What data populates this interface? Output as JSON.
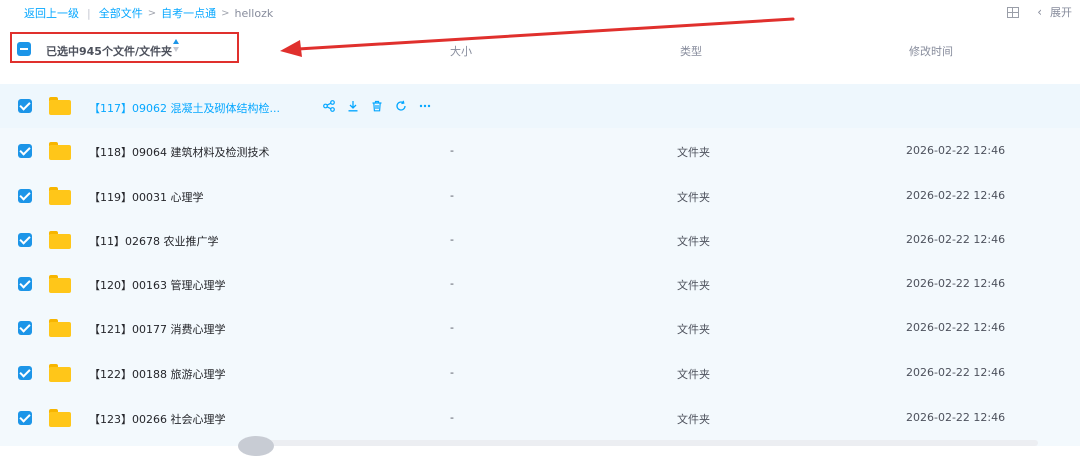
{
  "breadcrumb": {
    "back": "返回上一级",
    "separator": "|",
    "items": [
      "全部文件",
      "自考一点通",
      "hellozk"
    ]
  },
  "top_right": {
    "expand_label": "展开"
  },
  "header": {
    "selected_label": "已选中945个文件/文件夹",
    "size_label": "大小",
    "type_label": "类型",
    "modified_label": "修改时间"
  },
  "rows": [
    {
      "name": "【117】09062 混凝土及砌体结构检...",
      "size": "",
      "type": "",
      "date": ""
    },
    {
      "name": "【118】09064 建筑材料及检测技术",
      "size": "-",
      "type": "文件夹",
      "date": "2026-02-22 12:46"
    },
    {
      "name": "【119】00031 心理学",
      "size": "-",
      "type": "文件夹",
      "date": "2026-02-22 12:46"
    },
    {
      "name": "【11】02678 农业推广学",
      "size": "-",
      "type": "文件夹",
      "date": "2026-02-22 12:46"
    },
    {
      "name": "【120】00163 管理心理学",
      "size": "-",
      "type": "文件夹",
      "date": "2026-02-22 12:46"
    },
    {
      "name": "【121】00177 消费心理学",
      "size": "-",
      "type": "文件夹",
      "date": "2026-02-22 12:46"
    },
    {
      "name": "【122】00188 旅游心理学",
      "size": "-",
      "type": "文件夹",
      "date": "2026-02-22 12:46"
    },
    {
      "name": "【123】00266 社会心理学",
      "size": "-",
      "type": "文件夹",
      "date": "2026-02-22 12:46"
    }
  ],
  "row_actions": [
    "share-icon",
    "download-icon",
    "delete-icon",
    "refresh-icon",
    "more-icon"
  ],
  "colors": {
    "accent": "#06a7ff",
    "checkbox": "#1c95e8",
    "highlight_border": "#e0302d",
    "arrow": "#e0302d",
    "folder": "#ffc619"
  }
}
